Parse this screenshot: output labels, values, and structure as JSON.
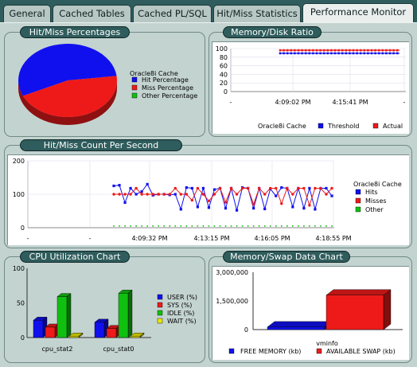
{
  "tabs": [
    {
      "label": "General",
      "active": false
    },
    {
      "label": "Cached Tables",
      "active": false
    },
    {
      "label": "Cached PL/SQL",
      "active": false
    },
    {
      "label": "Hit/Miss Statistics",
      "active": false
    },
    {
      "label": "Performance Monitor",
      "active": true
    }
  ],
  "colors": {
    "blue": "#1010ee",
    "red": "#ee1a1a",
    "green": "#10c010",
    "yellow": "#e8e800",
    "panel": "#c3d3d0",
    "header": "#2f5c5c"
  },
  "panels": {
    "hit_miss_percentages": "Hit/Miss Percentages",
    "memory_disk_ratio": "Memory/Disk Ratio",
    "hit_miss_count": "Hit/Miss Count Per Second",
    "cpu_utilization": "CPU Utilization Chart",
    "memory_swap": "Memory/Swap Data Chart"
  },
  "chart_data": [
    {
      "id": "hit_miss_percentages",
      "type": "pie",
      "legend_title": "Oracle8i Cache",
      "legend_position": "right",
      "slices": [
        {
          "name": "Hit Percentage",
          "value": 55,
          "color": "#1010ee"
        },
        {
          "name": "Miss Percentage",
          "value": 45,
          "color": "#ee1a1a"
        },
        {
          "name": "Other Percentage",
          "value": 0,
          "color": "#10c010"
        }
      ]
    },
    {
      "id": "memory_disk_ratio",
      "type": "line",
      "legend_title": "Oracle8i Cache",
      "legend_position": "bottom",
      "ylim": [
        0,
        100
      ],
      "yticks": [
        "100",
        "80",
        "60",
        "40",
        "20",
        "0"
      ],
      "xticks": [
        "-",
        "4:09:02 PM",
        "4:15:41 PM",
        "-"
      ],
      "series": [
        {
          "name": "Threshold",
          "color": "#1010ee",
          "value": 89,
          "start_tick": "4:09:02 PM"
        },
        {
          "name": "Actual",
          "color": "#ee1a1a",
          "value": 96,
          "start_tick": "4:09:02 PM"
        }
      ]
    },
    {
      "id": "hit_miss_count",
      "type": "line",
      "legend_title": "Oracle8i Cache",
      "legend_position": "right",
      "ylim": [
        0,
        200
      ],
      "yticks": [
        "200",
        "100",
        "0"
      ],
      "xticks": [
        "-",
        "-",
        "4:09:32 PM",
        "4:13:15 PM",
        "4:16:05 PM",
        "4:18:55 PM"
      ],
      "series": [
        {
          "name": "Hits",
          "color": "#1010ee",
          "values": [
            125,
            127,
            75,
            118,
            100,
            108,
            130,
            97,
            100,
            100,
            98,
            100,
            55,
            120,
            118,
            62,
            118,
            60,
            114,
            118,
            58,
            118,
            52,
            120,
            118,
            58,
            118,
            56,
            116,
            95,
            120,
            118,
            62,
            118,
            58,
            118,
            55,
            118,
            118,
            95
          ]
        },
        {
          "name": "Misses",
          "color": "#ee1a1a",
          "values": [
            100,
            100,
            100,
            100,
            118,
            100,
            100,
            100,
            100,
            100,
            100,
            118,
            100,
            100,
            82,
            118,
            100,
            80,
            100,
            118,
            76,
            118,
            100,
            118,
            118,
            70,
            118,
            100,
            118,
            118,
            72,
            118,
            100,
            118,
            118,
            67,
            118,
            117,
            100,
            118
          ]
        },
        {
          "name": "Other",
          "color": "#10c010",
          "values": [
            5,
            5,
            5,
            5,
            5,
            5,
            5,
            5,
            5,
            5,
            5,
            5,
            5,
            5,
            5,
            5,
            5,
            5,
            5,
            5,
            5,
            5,
            5,
            5,
            5,
            5,
            5,
            5,
            5,
            5,
            5,
            5,
            5,
            5,
            5,
            5,
            5,
            5,
            5,
            5
          ]
        }
      ]
    },
    {
      "id": "cpu_utilization",
      "type": "bar",
      "legend_position": "right",
      "ylim": [
        0,
        100
      ],
      "yticks": [
        "100",
        "50",
        "0"
      ],
      "categories": [
        "cpu_stat2",
        "cpu_stat0"
      ],
      "series": [
        {
          "name": "USER (%)",
          "color": "#1010ee",
          "values": [
            25,
            22
          ]
        },
        {
          "name": "SYS (%)",
          "color": "#ee1a1a",
          "values": [
            15,
            13
          ]
        },
        {
          "name": "IDLE (%)",
          "color": "#10c010",
          "values": [
            59,
            64
          ]
        },
        {
          "name": "WAIT (%)",
          "color": "#e8e800",
          "values": [
            2,
            2
          ]
        }
      ]
    },
    {
      "id": "memory_swap",
      "type": "bar",
      "legend_position": "bottom",
      "ylim": [
        0,
        3000000
      ],
      "yticks": [
        "3,000,000",
        "1,500,000",
        "0"
      ],
      "categories": [
        "vminfo"
      ],
      "series": [
        {
          "name": "FREE MEMORY (kb)",
          "color": "#1010ee",
          "values": [
            130000
          ]
        },
        {
          "name": "AVAILABLE SWAP (kb)",
          "color": "#ee1a1a",
          "values": [
            1800000
          ]
        }
      ]
    }
  ]
}
